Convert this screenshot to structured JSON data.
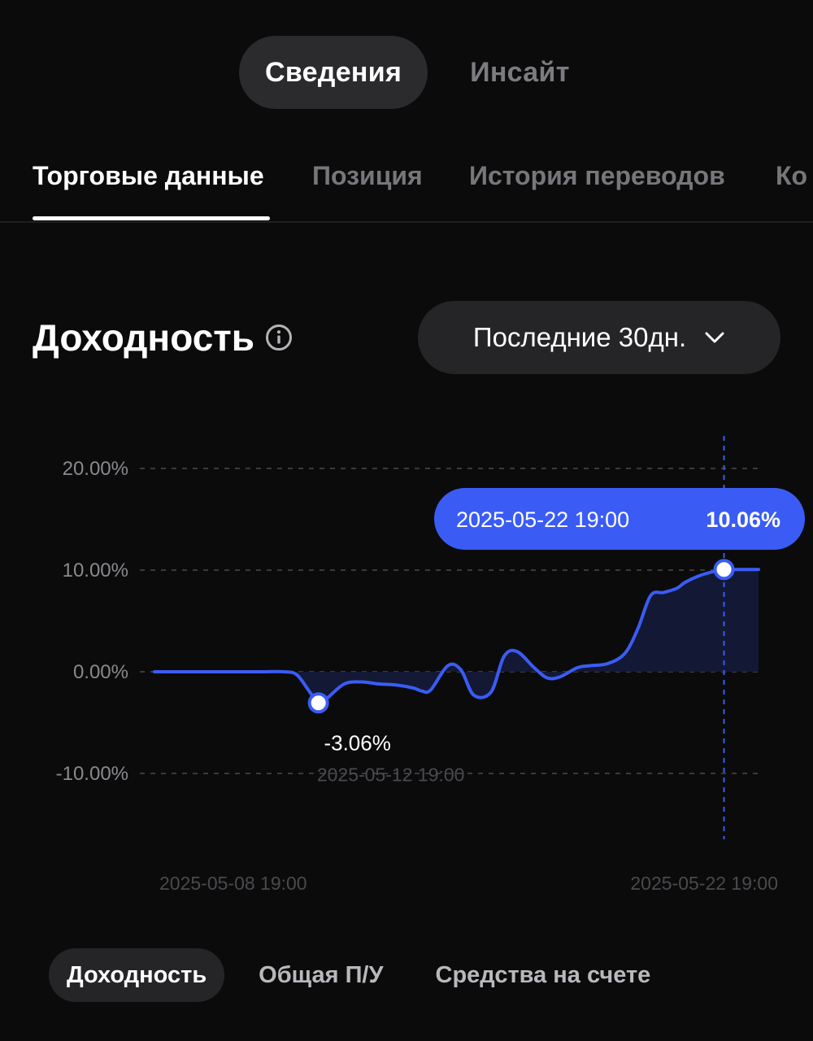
{
  "top_switch": {
    "active": "Сведения",
    "inactive": "Инсайт"
  },
  "tabs": [
    "Торговые данные",
    "Позиция",
    "История переводов",
    "Ко"
  ],
  "section": {
    "title": "Доходность",
    "period": "Последние 30дн."
  },
  "colors": {
    "background": "#0b0b0c",
    "accent": "#3a5cf5",
    "fill": "#141a3a"
  },
  "icons": {
    "info": "info-circle-icon",
    "dropdown": "chevron-down-icon"
  },
  "chart_data": {
    "type": "area",
    "y_tick_labels": [
      "20.00%",
      "10.00%",
      "0.00%",
      "-10.00%"
    ],
    "y_ticks": [
      20,
      10,
      0,
      -10
    ],
    "ylim": [
      -17,
      23
    ],
    "x_tick_labels": [
      "2025-05-08 19:00",
      "2025-05-22 19:00"
    ],
    "x_range": [
      0,
      14
    ],
    "grid": true,
    "series": [
      {
        "x": [
          0,
          0.5,
          1,
          1.5,
          2,
          2.5,
          3,
          3.3,
          3.6,
          3.8,
          4.0,
          4.4,
          4.8,
          5.2,
          5.6,
          6.0,
          6.2,
          6.4,
          6.8,
          7.1,
          7.4,
          7.8,
          8.1,
          8.4,
          8.8,
          9.1,
          9.4,
          9.8,
          10.1,
          10.5,
          10.9,
          11.2,
          11.5,
          11.8,
          12.1,
          12.3,
          12.6,
          12.9,
          13.2,
          13.5,
          14.0
        ],
        "y": [
          0,
          0,
          0,
          0,
          0,
          0,
          0,
          -0.3,
          -2.0,
          -3.06,
          -2.6,
          -1.2,
          -1.0,
          -1.2,
          -1.3,
          -1.6,
          -1.9,
          -1.8,
          0.6,
          0.2,
          -2.3,
          -2.0,
          1.5,
          2.0,
          0.4,
          -0.6,
          -0.5,
          0.4,
          0.6,
          0.8,
          1.8,
          4.2,
          7.5,
          7.8,
          8.2,
          8.8,
          9.4,
          9.8,
          10.06,
          10.06,
          10.06
        ]
      }
    ],
    "highlights": [
      {
        "x": 3.8,
        "y": -3.06,
        "value_label": "-3.06%",
        "date_label": "2025-05-12 19:00"
      },
      {
        "x": 13.2,
        "y": 10.06,
        "date_label": "2025-05-22 19:00",
        "value_label": "10.06%"
      }
    ]
  },
  "bottom_tabs": [
    "Доходность",
    "Общая П/У",
    "Средства на счете"
  ]
}
